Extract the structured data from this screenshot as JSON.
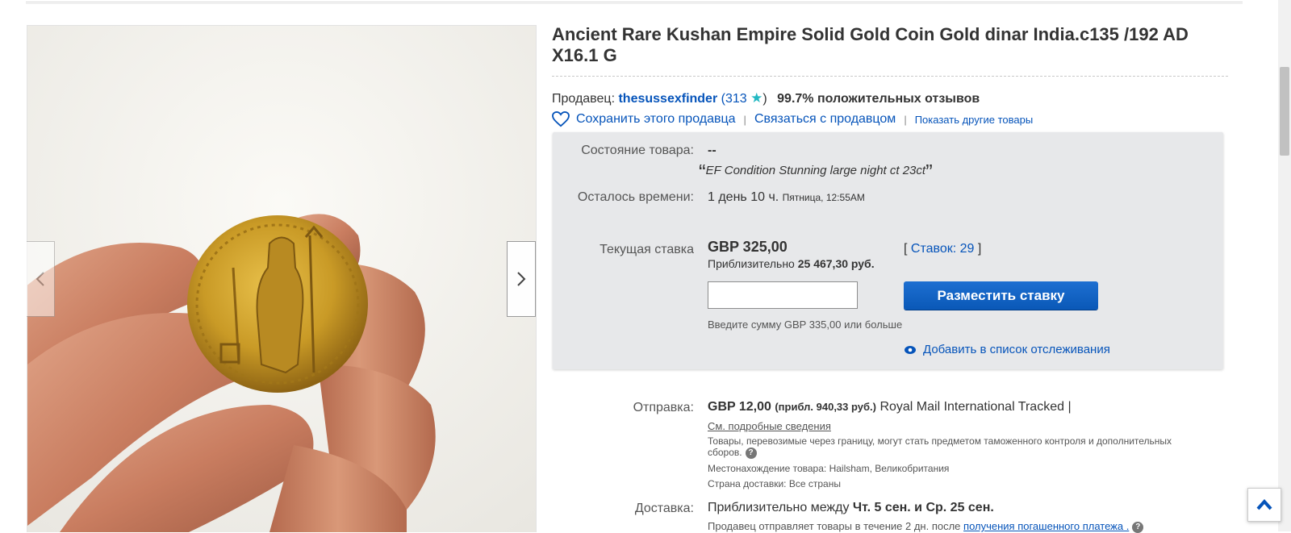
{
  "listing": {
    "title": "Ancient Rare Kushan Empire Solid Gold Coin Gold dinar India.c135 /192 AD X16.1 G"
  },
  "seller": {
    "prefix": "Продавец:",
    "name": "thesussexfinder",
    "score_open": "(",
    "score": "313",
    "score_close": ")",
    "feedback": "99.7% положительных отзывов",
    "save_label": "Сохранить этого продавца",
    "contact_label": "Связаться с продавцом",
    "other_items_label": "Показать другие товары",
    "separator": "|"
  },
  "item": {
    "condition_label": "Состояние товара:",
    "condition_value": "--",
    "condition_note": "EF Condition Stunning large night ct 23ct",
    "quote_open": "“",
    "quote_close": "”",
    "time_label": "Осталось времени:",
    "time_left": "1 день 10 ч.",
    "time_end": "Пятница, 12:55AM"
  },
  "bid": {
    "current_label": "Текущая ставка",
    "current_price": "GBP 325,00",
    "approx_prefix": "Приблизительно",
    "approx_value": "25 467,30 руб.",
    "bids_open": "[",
    "bids_link": "Ставок: 29",
    "bids_close": "]",
    "input_value": "",
    "button_label": "Разместить ставку",
    "hint": "Введите сумму GBP 335,00 или больше",
    "watch_label": "Добавить в список отслеживания"
  },
  "shipping": {
    "label": "Отправка:",
    "price": "GBP 12,00",
    "approx": "(прибл. 940,33 руб.)",
    "service": "Royal Mail International Tracked |",
    "details_link": "См. подробные сведения",
    "customs_note": "Товары, перевозимые через границу, могут стать предметом таможенного контроля и дополнительных сборов.",
    "location_label": "Местонахождение товара:",
    "location_value": "Hailsham, Великобритания",
    "ships_to_label": "Страна доставки:",
    "ships_to_value": "Все страны"
  },
  "delivery": {
    "label": "Доставка:",
    "prefix": "Приблизительно между",
    "range": "Чт. 5 сен. и Ср. 25 сен.",
    "note_prefix": "Продавец отправляет товары в течение 2 дн. после",
    "note_link": "получения погашенного платежа ."
  },
  "icons": {
    "prev": "chevron-left-icon",
    "next": "chevron-right-icon",
    "heart": "heart-icon",
    "star": "star-icon",
    "eye": "eye-icon",
    "help": "question-icon",
    "top": "chevron-up-icon"
  },
  "colors": {
    "link": "#0654ba",
    "button": "#0654ba",
    "star": "#22b8c2",
    "bidbox": "#e7e8ea"
  }
}
